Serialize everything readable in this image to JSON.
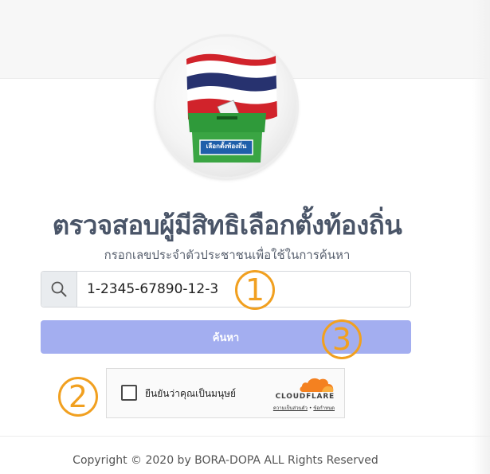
{
  "logo": {
    "box_label": "เลือกตั้งท้องถิ่น",
    "colors": {
      "flag_red": "#d1232b",
      "flag_white": "#ffffff",
      "flag_blue": "#27326f",
      "ballot_box_green": "#3aa543"
    }
  },
  "header": {
    "title": "ตรวจสอบผู้มีสิทธิเลือกตั้งท้องถิ่น",
    "subtitle": "กรอกเลขประจำตัวประชาชนเพื่อใช้ในการค้นหา"
  },
  "search": {
    "icon": "search-icon",
    "value": "1-2345-67890-12-3",
    "button_label": "ค้นหา",
    "button_color": "#a3aef0"
  },
  "captcha": {
    "label": "ยืนยันว่าคุณเป็นมนุษย์",
    "provider": "CLOUDFLARE",
    "privacy_link": "ความเป็นส่วนตัว",
    "separator": "•",
    "terms_link": "ข้อกำหนด",
    "checked": false
  },
  "annotations": {
    "color": "#f1a020",
    "marker_1": "1",
    "marker_2": "2",
    "marker_3": "3"
  },
  "footer": {
    "copyright": "Copyright © 2020 by BORA-DOPA ALL Rights Reserved"
  }
}
